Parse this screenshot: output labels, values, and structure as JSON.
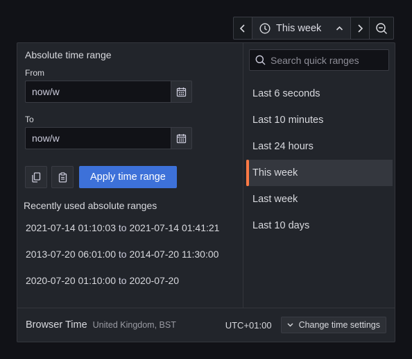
{
  "toolbar": {
    "range_label": "This week",
    "icons": [
      "chevron-left-icon",
      "clock-icon",
      "chevron-up-icon",
      "chevron-right-icon",
      "zoom-out-icon"
    ]
  },
  "absolute": {
    "heading": "Absolute time range",
    "from_label": "From",
    "from_value": "now/w",
    "to_label": "To",
    "to_value": "now/w",
    "apply_label": "Apply time range"
  },
  "recent": {
    "heading": "Recently used absolute ranges",
    "items": [
      {
        "from": "2021-07-14 01:10:03",
        "sep": "to",
        "to": "2021-07-14 01:41:21"
      },
      {
        "from": "2013-07-20 06:01:00",
        "sep": "to",
        "to": "2014-07-20 11:30:00"
      },
      {
        "from": "2020-07-20 01:10:00",
        "sep": "to",
        "to": "2020-07-20"
      }
    ]
  },
  "quick": {
    "search_placeholder": "Search quick ranges",
    "items": [
      {
        "label": "Last 6 seconds"
      },
      {
        "label": "Last 10 minutes"
      },
      {
        "label": "Last 24 hours"
      },
      {
        "label": "This week",
        "active": true
      },
      {
        "label": "Last week"
      },
      {
        "label": "Last 10 days"
      }
    ]
  },
  "footer": {
    "tz_label": "Browser Time",
    "location": "United Kingdom, BST",
    "utc": "UTC+01:00",
    "settings_label": "Change time settings"
  },
  "colors": {
    "accent": "#3d71d9",
    "active_marker": "#ff7a45",
    "panel_bg": "#22252b",
    "page_bg": "#111217"
  }
}
